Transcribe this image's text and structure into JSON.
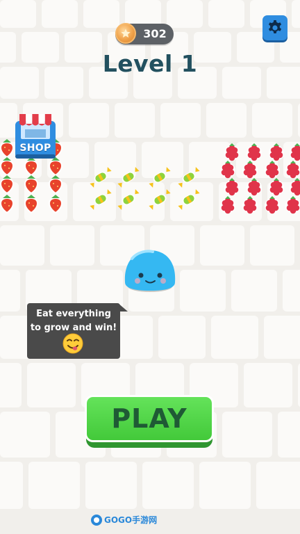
{
  "hud": {
    "coin_count": "302",
    "level_title": "Level 1"
  },
  "shop": {
    "label": "SHOP"
  },
  "tutorial": {
    "line1": "Eat everything",
    "line2": "to grow and win!"
  },
  "play": {
    "label": "PLAY"
  },
  "watermark": {
    "text": "GOGO手游网"
  },
  "icons": {
    "coin": "star-coin-icon",
    "settings": "gear-icon",
    "shop": "shop-stall-icon",
    "emoji": "yum-face-emoji",
    "player": "blue-slime-character",
    "food": [
      "strawberry-icon",
      "candy-icon",
      "raspberry-icon"
    ]
  },
  "colors": {
    "accent_blue": "#2f8de0",
    "play_green": "#43c93a",
    "level_text": "#22505f",
    "slime": "#35b8f2",
    "coin_pill": "#5d6166"
  }
}
